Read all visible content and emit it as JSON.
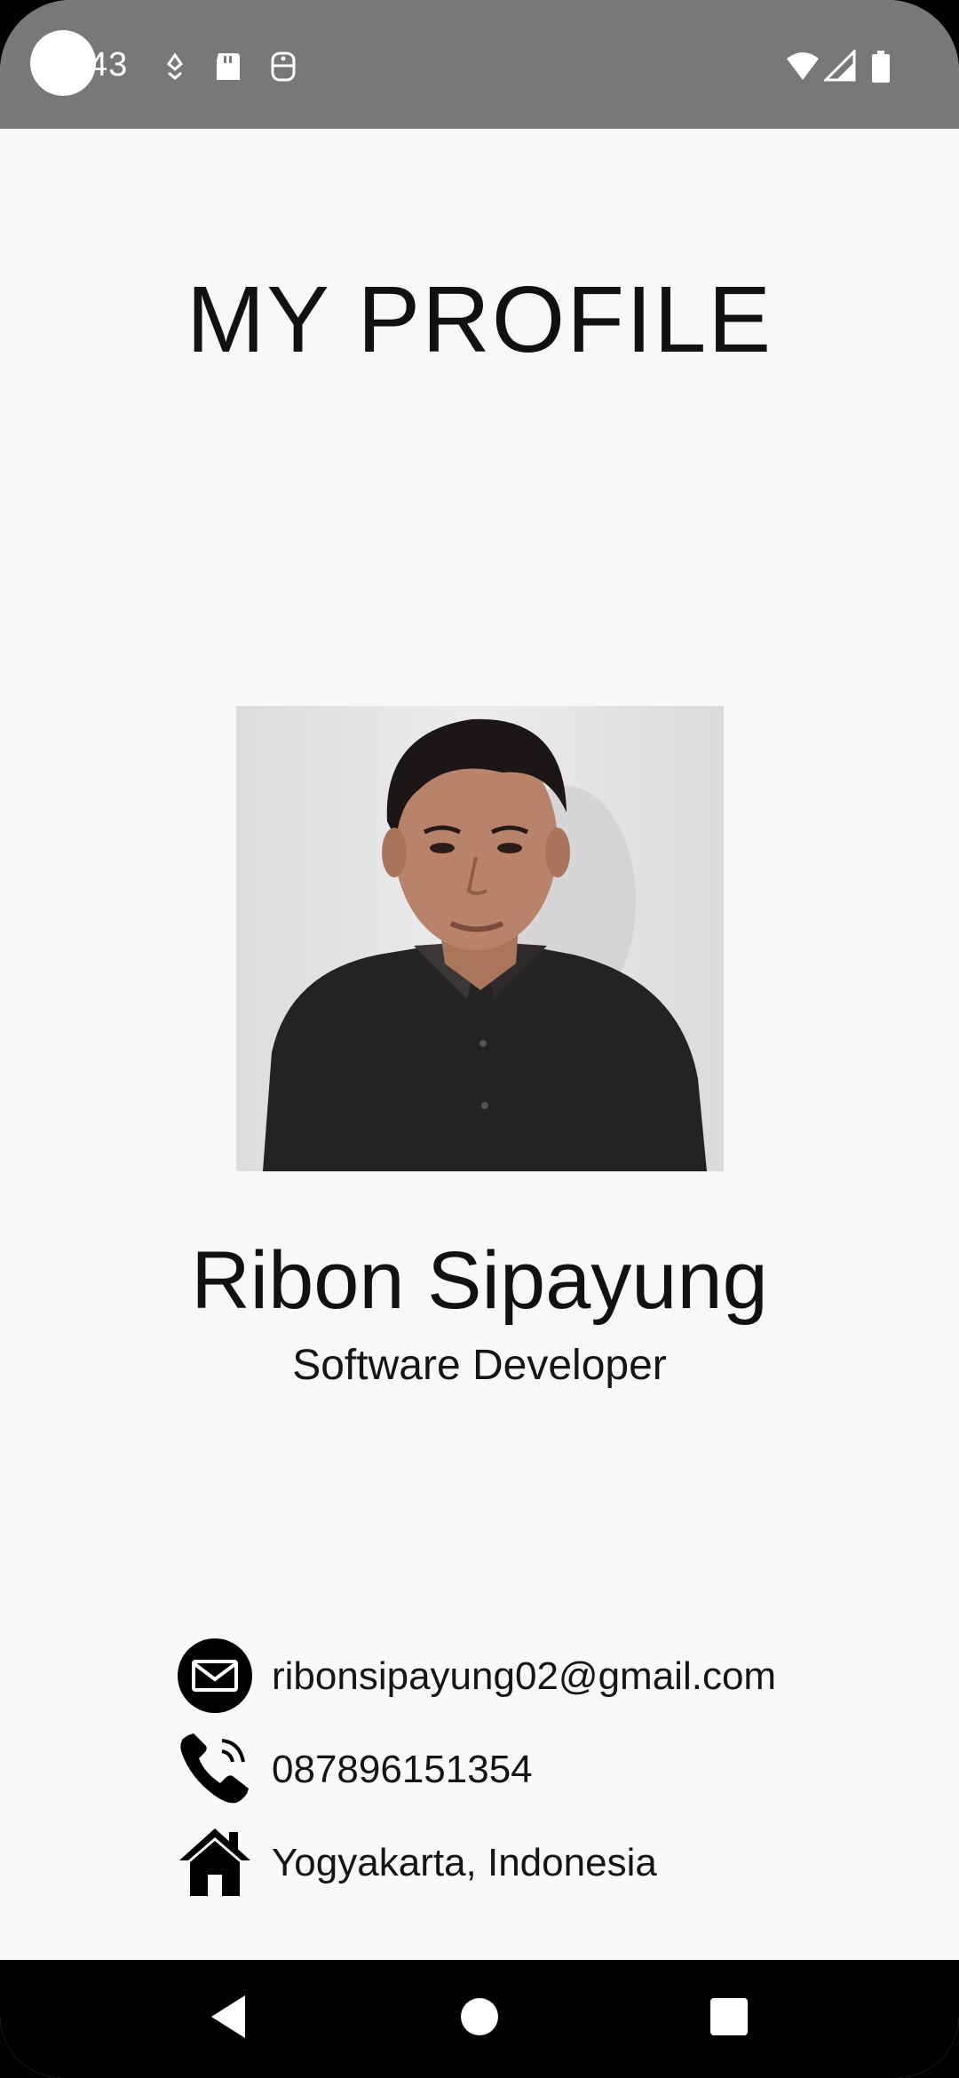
{
  "status_bar": {
    "time": "43",
    "icons": [
      "notification-icon",
      "sd-card-icon",
      "data-saver-icon",
      "wifi-icon",
      "signal-icon",
      "battery-icon"
    ]
  },
  "profile": {
    "title": "MY PROFILE",
    "name": "Ribon Sipayung",
    "role": "Software Developer"
  },
  "contacts": [
    {
      "icon": "email-icon",
      "text": "ribonsipayung02@gmail.com"
    },
    {
      "icon": "phone-icon",
      "text": "087896151354"
    },
    {
      "icon": "home-icon",
      "text": "Yogyakarta, Indonesia"
    }
  ],
  "nav": {
    "buttons": [
      "back-button",
      "home-button",
      "recents-button"
    ]
  }
}
